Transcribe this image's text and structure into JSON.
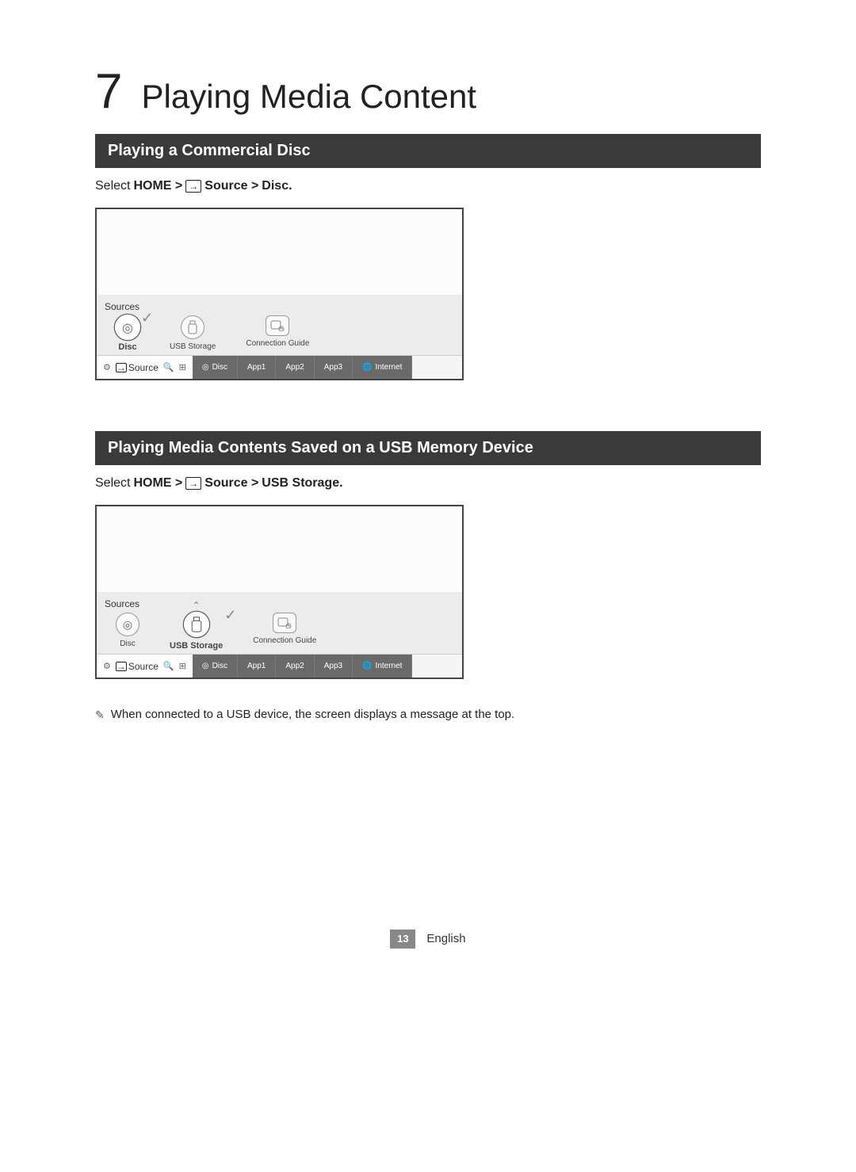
{
  "chapter": {
    "number": "7",
    "title": "Playing Media Content"
  },
  "section1": {
    "heading": "Playing  a Commercial Disc",
    "instr_select": "Select ",
    "instr_home": "HOME > ",
    "instr_source": " Source > ",
    "instr_target": "Disc.",
    "tv": {
      "sources_label": "Sources",
      "items": {
        "disc": "Disc",
        "usb": "USB Storage",
        "guide": "Connection Guide"
      },
      "launcher": {
        "source_word": "Source",
        "disc": "Disc",
        "app1": "App1",
        "app2": "App2",
        "app3": "App3",
        "internet": "Internet"
      }
    }
  },
  "section2": {
    "heading": "Playing Media Contents Saved on a USB Memory Device",
    "instr_select": "Select ",
    "instr_home": "HOME > ",
    "instr_source": " Source > ",
    "instr_target": "USB Storage.",
    "tv": {
      "sources_label": "Sources",
      "items": {
        "disc": "Disc",
        "usb": "USB Storage",
        "guide": "Connection Guide"
      },
      "launcher": {
        "source_word": "Source",
        "disc": "Disc",
        "app1": "App1",
        "app2": "App2",
        "app3": "App3",
        "internet": "Internet"
      }
    },
    "note": "When connected to a USB device, the screen displays a message at the top."
  },
  "footer": {
    "page": "13",
    "lang": "English"
  }
}
